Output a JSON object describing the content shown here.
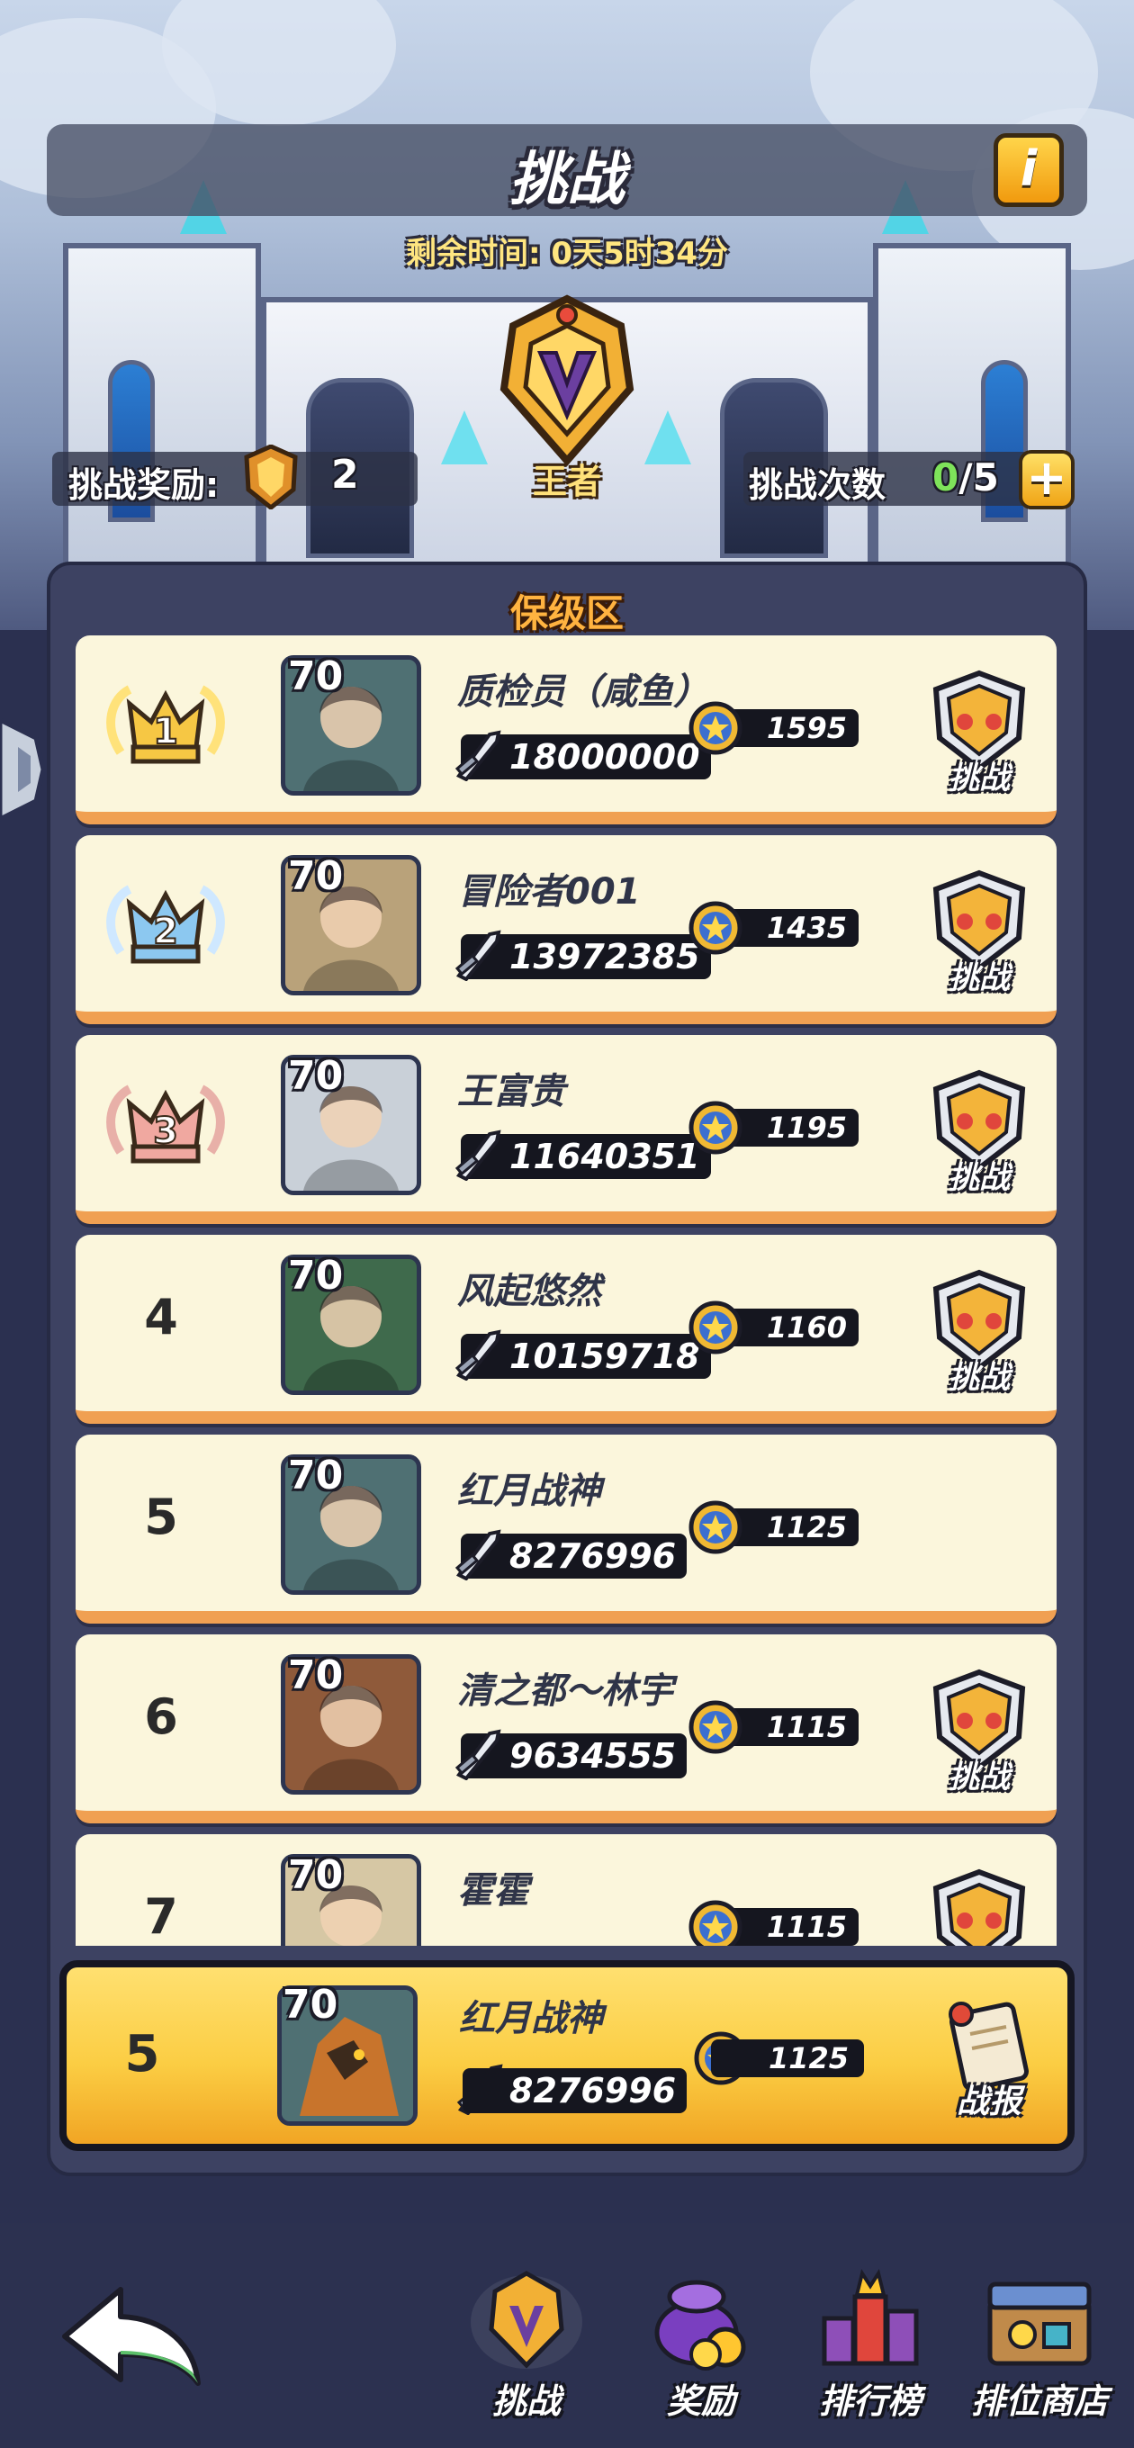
{
  "header": {
    "title": "挑战",
    "info_icon": "info-icon",
    "timer_text": "剩余时间: 0天5时34分",
    "rank_name": "王者",
    "reward_label": "挑战奖励:",
    "reward_count": "2",
    "attempts_label": "挑战次数",
    "attempts_used": "0",
    "attempts_total": "/5",
    "add_icon": "plus-icon"
  },
  "zone": {
    "title": "保级区"
  },
  "challenge_label": "挑战",
  "players": [
    {
      "rank": "1",
      "level": "70",
      "name": "质检员（咸鱼）",
      "power": "18000000",
      "score": "1595",
      "challengeable": true
    },
    {
      "rank": "2",
      "level": "70",
      "name": "冒险者001",
      "power": "13972385",
      "score": "1435",
      "challengeable": true
    },
    {
      "rank": "3",
      "level": "70",
      "name": "王富贵",
      "power": "11640351",
      "score": "1195",
      "challengeable": true
    },
    {
      "rank": "4",
      "level": "70",
      "name": "风起悠然",
      "power": "10159718",
      "score": "1160",
      "challengeable": true
    },
    {
      "rank": "5",
      "level": "70",
      "name": "红月战神",
      "power": "8276996",
      "score": "1125",
      "challengeable": false
    },
    {
      "rank": "6",
      "level": "70",
      "name": "清之都～林宇",
      "power": "9634555",
      "score": "1115",
      "challengeable": true
    },
    {
      "rank": "7",
      "level": "70",
      "name": "霍霍",
      "power": "",
      "score": "1115",
      "challengeable": true
    }
  ],
  "me": {
    "rank": "5",
    "level": "70",
    "name": "红月战神",
    "power": "8276996",
    "score": "1125",
    "report_label": "战报"
  },
  "nav": {
    "back_icon": "back-arrow-icon",
    "tabs": [
      {
        "label": "挑战",
        "icon": "challenge-emblem-icon",
        "active": true
      },
      {
        "label": "奖励",
        "icon": "reward-bag-icon",
        "active": false
      },
      {
        "label": "排行榜",
        "icon": "leaderboard-icon",
        "active": false
      },
      {
        "label": "排位商店",
        "icon": "shop-icon",
        "active": false
      }
    ]
  },
  "colors": {
    "row_bg": "#fbf6dc",
    "row_edge": "#f0a052",
    "my_row": "#fbcd43",
    "panel": "#3d4262",
    "accent_gold": "#ffb340"
  }
}
